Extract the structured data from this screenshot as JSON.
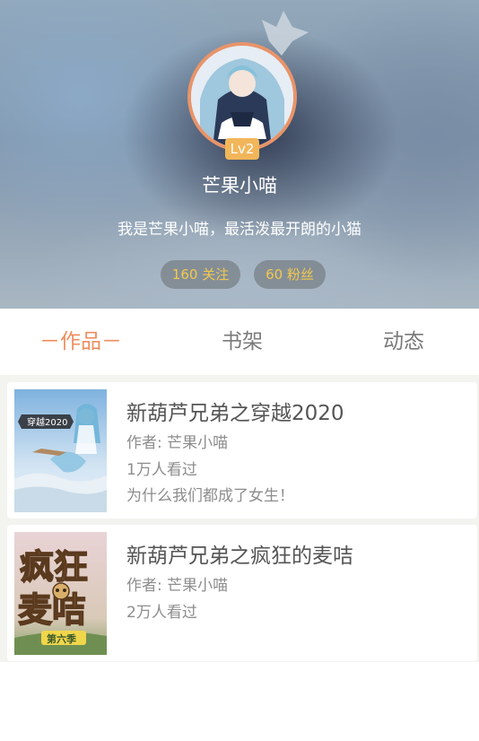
{
  "profile": {
    "level": "Lv2",
    "username": "芒果小喵",
    "bio": "我是芒果小喵，最活泼最开朗的小猫",
    "following_label": "160 关注",
    "fans_label": "60 粉丝",
    "crown_icon": "crown-icon",
    "colors": {
      "ring": "#e8946a",
      "badge": "#f2b65a",
      "stat_text": "#f2c94c"
    }
  },
  "tabs": [
    {
      "label": "－作品－",
      "active": true
    },
    {
      "label": "书架",
      "active": false
    },
    {
      "label": "动态",
      "active": false
    }
  ],
  "active_tab_color": "#ee8d5e",
  "books": [
    {
      "title": "新葫芦兄弟之穿越2020",
      "author": "作者: 芒果小喵",
      "views": "1万人看过",
      "description": "为什么我们都成了女生！",
      "cover_sign": "穿越2020"
    },
    {
      "title": "新葫芦兄弟之疯狂的麦咭",
      "author": "作者: 芒果小喵",
      "views": "2万人看过",
      "description": "",
      "cover_big": "疯狂麦咭",
      "cover_small": "第六季"
    }
  ]
}
